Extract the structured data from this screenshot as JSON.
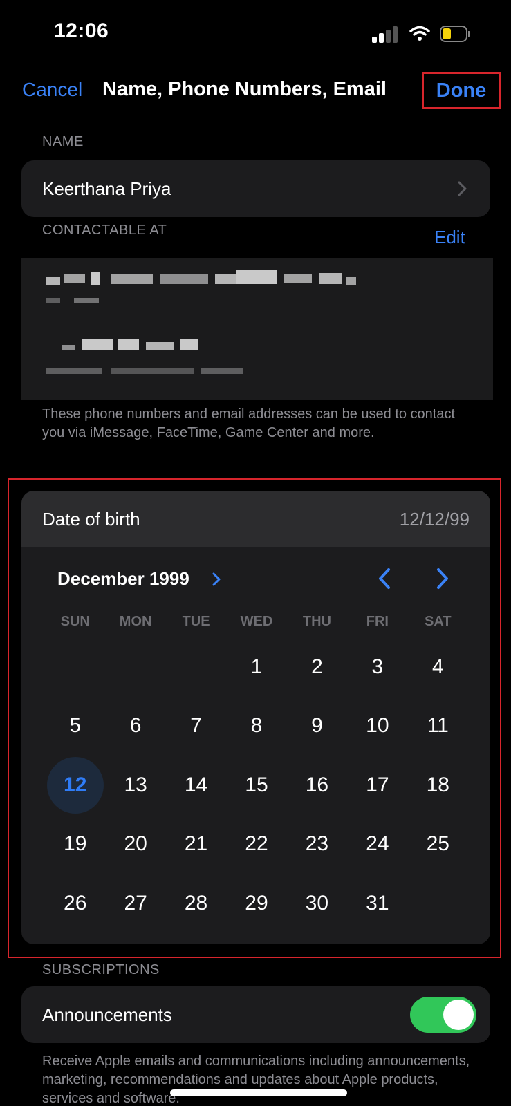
{
  "status_bar": {
    "time": "12:06",
    "battery_color": "#f5d30b"
  },
  "nav": {
    "cancel_label": "Cancel",
    "title": "Name, Phone Numbers, Email",
    "done_label": "Done"
  },
  "name_section": {
    "label": "NAME",
    "value": "Keerthana Priya"
  },
  "contact_section": {
    "label": "CONTACTABLE AT",
    "edit_label": "Edit",
    "note": "These phone numbers and email addresses can be used to contact you via iMessage, FaceTime, Game Center and more."
  },
  "birth": {
    "label": "Date of birth",
    "value": "12/12/99",
    "month_label": "December 1999",
    "weekdays": [
      "SUN",
      "MON",
      "TUE",
      "WED",
      "THU",
      "FRI",
      "SAT"
    ],
    "first_weekday_index": 3,
    "days_in_month": 31,
    "selected_day": 12
  },
  "subscriptions": {
    "label": "SUBSCRIPTIONS",
    "item_label": "Announcements",
    "toggle_on": true,
    "note": "Receive Apple emails and communications including announcements, marketing, recommendations and updates about Apple products, services and software."
  },
  "colors": {
    "accent": "#3a82f7",
    "toggle_on": "#31c759",
    "highlight": "#d7252c"
  }
}
